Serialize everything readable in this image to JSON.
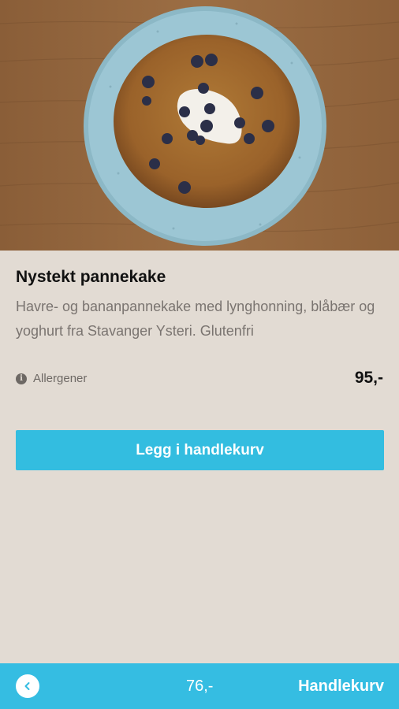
{
  "product": {
    "image_alt": "pancake-photo",
    "title": "Nystekt pannekake",
    "description": "Havre- og bananpannekake med lynghonning, blåbær og yoghurt fra Stavanger Ysteri. Glutenfri",
    "allergen_icon": "info-icon",
    "allergen_label": "Allergener",
    "price": "95,-",
    "add_button_label": "Legg i handlekurv"
  },
  "bottom_bar": {
    "back_icon": "chevron-left-icon",
    "total": "76,-",
    "cart_label": "Handlekurv"
  },
  "colors": {
    "accent": "#33bde0",
    "background": "#e2dbd3"
  }
}
